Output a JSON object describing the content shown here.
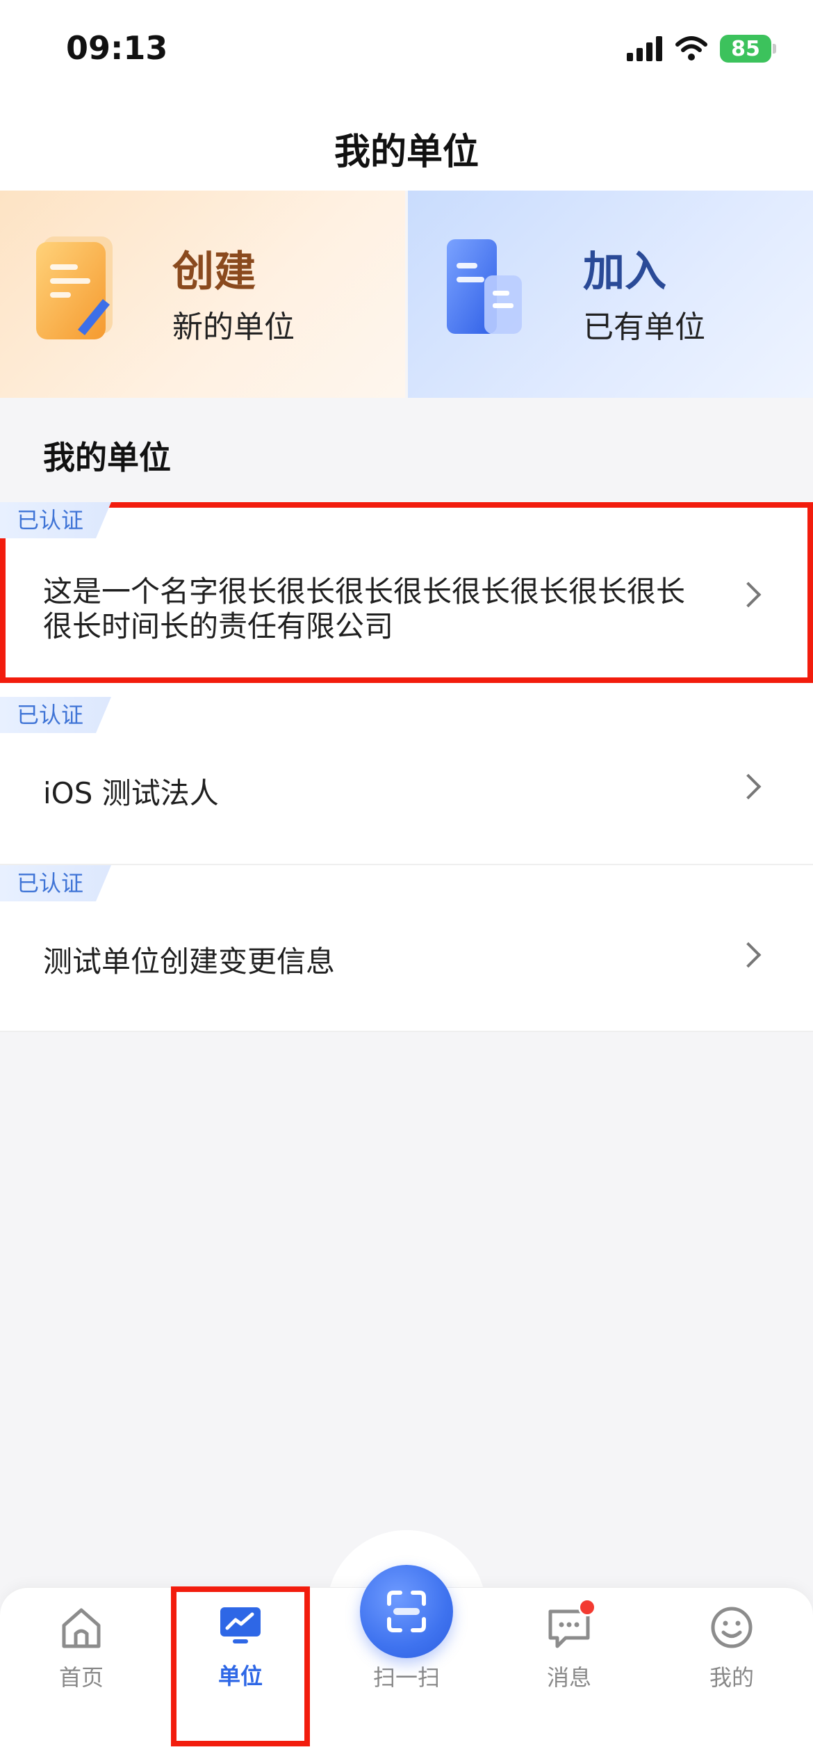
{
  "status_bar": {
    "time": "09:13",
    "battery": "85"
  },
  "header": {
    "title": "我的单位"
  },
  "actions": {
    "create": {
      "title": "创建",
      "subtitle": "新的单位"
    },
    "join": {
      "title": "加入",
      "subtitle": "已有单位"
    }
  },
  "section": {
    "title": "我的单位"
  },
  "units": [
    {
      "badge": "已认证",
      "name": "这是一个名字很长很长很长很长很长很长很长很长很长时间长的责任有限公司"
    },
    {
      "badge": "已认证",
      "name": "iOS 测试法人"
    },
    {
      "badge": "已认证",
      "name": "测试单位创建变更信息"
    }
  ],
  "tabs": [
    {
      "label": "首页",
      "icon": "home-icon"
    },
    {
      "label": "单位",
      "icon": "unit-chart-icon"
    },
    {
      "label": "扫一扫",
      "icon": "scan-icon"
    },
    {
      "label": "消息",
      "icon": "message-icon"
    },
    {
      "label": "我的",
      "icon": "smiley-icon"
    }
  ],
  "colors": {
    "accent": "#2e67e6",
    "badge_text": "#3f74d6",
    "highlight": "#f21c0d"
  }
}
